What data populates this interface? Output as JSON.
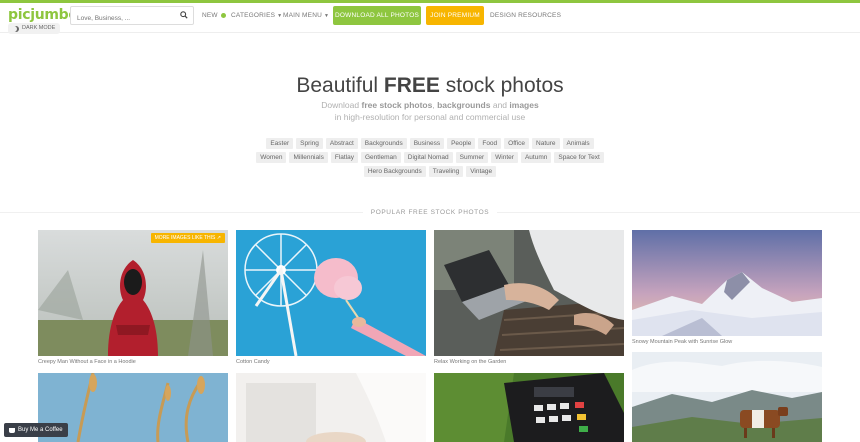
{
  "header": {
    "logo": "picjumbo",
    "dark_mode_label": "DARK MODE",
    "search_placeholder": "Love, Business, ...",
    "nav_new": "NEW",
    "nav_categories": "CATEGORIES",
    "nav_main_menu": "MAIN MENU",
    "btn_download_all": "DOWNLOAD ALL PHOTOS",
    "btn_join_premium": "JOIN PREMIUM",
    "nav_design_resources": "DESIGN RESOURCES"
  },
  "hero": {
    "title_prefix": "Beautiful",
    "title_bold": "FREE",
    "title_suffix": "stock photos",
    "sub_line1_a": "Download",
    "sub_line1_b": "free stock photos",
    "sub_line1_c": ",",
    "sub_line1_d": "backgrounds",
    "sub_line1_e": "and",
    "sub_line1_f": "images",
    "sub_line2": "in high-resolution for personal and commercial use"
  },
  "tags_row1": [
    "Easter",
    "Spring",
    "Abstract",
    "Backgrounds",
    "Business",
    "People",
    "Food",
    "Office",
    "Nature",
    "Animals"
  ],
  "tags_row2": [
    "Women",
    "Millennials",
    "Flatlay",
    "Gentleman",
    "Digital Nomad",
    "Summer",
    "Winter",
    "Autumn",
    "Space for Text"
  ],
  "tags_row3": [
    "Hero Backgrounds",
    "Traveling",
    "Vintage"
  ],
  "section_title": "POPULAR FREE STOCK PHOTOS",
  "photos": {
    "p1_caption": "Creepy Man Without a Face in a Hoodie",
    "p1_badge": "MORE IMAGES LIKE THIS",
    "p2_caption": "Cotton Candy",
    "p3_caption": "Relax Working on the Garden",
    "p4_caption": "Snowy Mountain Peak with Sunrise Glow"
  },
  "buy_coffee": "Buy Me a Coffee"
}
